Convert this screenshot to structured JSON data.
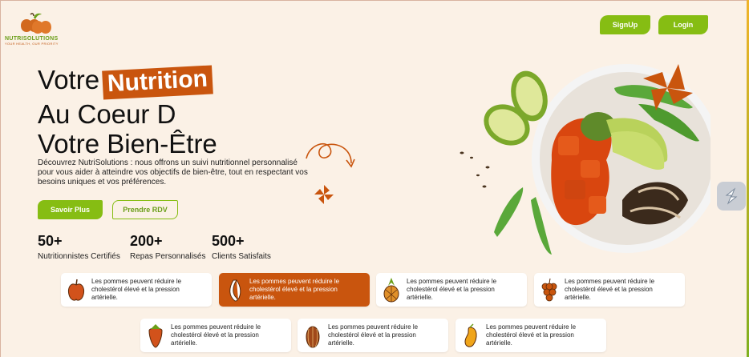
{
  "brand": {
    "name": "NUTRISOLUTIONS",
    "tagline": "YOUR HEALTH, OUR PRIORITY"
  },
  "nav": {
    "signup": "SignUp",
    "login": "Login"
  },
  "hero": {
    "line1_prefix": "Votre",
    "line1_badge": "Nutrition",
    "line2": "Au Coeur D",
    "line3": "Votre Bien-Être",
    "description": "Découvrez NutriSolutions : nous offrons un suivi nutritionnel personnalisé pour vous aider à atteindre vos objectifs de bien-être, tout en respectant vos besoins uniques et vos préférences.",
    "cta_primary": "Savoir Plus",
    "cta_secondary": "Prendre RDV"
  },
  "stats": [
    {
      "value": "50+",
      "label": "Nutritionnistes Certifiés"
    },
    {
      "value": "200+",
      "label": "Repas Personnalisés"
    },
    {
      "value": "500+",
      "label": "Clients Satisfaits"
    }
  ],
  "facts": [
    {
      "icon": "apple-icon",
      "text": "Les pommes peuvent réduire le cholestérol élevé et la pression artérielle.",
      "active": false
    },
    {
      "icon": "banana-icon",
      "text": "Les pommes peuvent réduire le cholestérol élevé et la pression artérielle.",
      "active": true
    },
    {
      "icon": "pineapple-icon",
      "text": "Les pommes peuvent réduire le cholestérol élevé et la pression artérielle.",
      "active": false
    },
    {
      "icon": "grapes-icon",
      "text": "Les pommes peuvent réduire le cholestérol élevé et la pression artérielle.",
      "active": false
    },
    {
      "icon": "strawberry-icon",
      "text": "Les pommes peuvent réduire le cholestérol élevé et la pression artérielle.",
      "active": false
    },
    {
      "icon": "melon-icon",
      "text": "Les pommes peuvent réduire le cholestérol élevé et la pression artérielle.",
      "active": false
    },
    {
      "icon": "mango-icon",
      "text": "Les pommes peuvent réduire le cholestérol élevé et la pression artérielle.",
      "active": false
    }
  ],
  "colors": {
    "accent": "#c9550e",
    "green": "#86bd13",
    "background": "#fbf1e6"
  }
}
